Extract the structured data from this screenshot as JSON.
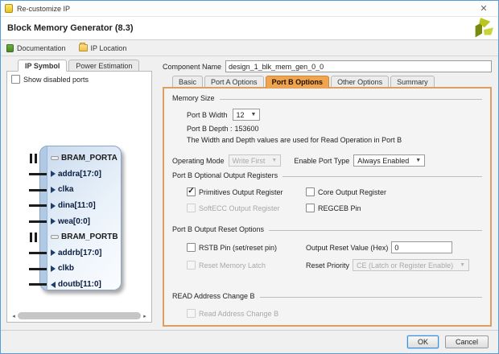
{
  "window": {
    "title": "Re-customize IP",
    "close_glyph": "✕"
  },
  "header": {
    "title": "Block Memory Generator (8.3)"
  },
  "toolbar": {
    "documentation_label": "Documentation",
    "ip_location_label": "IP Location"
  },
  "left_panel": {
    "tabs": [
      {
        "label": "IP Symbol"
      },
      {
        "label": "Power Estimation"
      }
    ],
    "show_disabled_ports_label": "Show disabled ports",
    "symbol_ports": [
      {
        "label": "BRAM_PORTA",
        "kind": "group"
      },
      {
        "label": "addra[17:0]",
        "kind": "input"
      },
      {
        "label": "clka",
        "kind": "input"
      },
      {
        "label": "dina[11:0]",
        "kind": "input"
      },
      {
        "label": "wea[0:0]",
        "kind": "input"
      },
      {
        "label": "BRAM_PORTB",
        "kind": "group"
      },
      {
        "label": "addrb[17:0]",
        "kind": "input"
      },
      {
        "label": "clkb",
        "kind": "input"
      },
      {
        "label": "doutb[11:0]",
        "kind": "output"
      }
    ]
  },
  "component_name": {
    "label": "Component Name",
    "value": "design_1_blk_mem_gen_0_0"
  },
  "config_tabs": [
    {
      "label": "Basic"
    },
    {
      "label": "Port A Options"
    },
    {
      "label": "Port B Options",
      "active": true
    },
    {
      "label": "Other Options"
    },
    {
      "label": "Summary"
    }
  ],
  "memory_size": {
    "title": "Memory Size",
    "port_b_width_label": "Port B Width",
    "port_b_width_value": "12",
    "port_b_depth_label": "Port B Depth :",
    "port_b_depth_value": "153600",
    "note": "The Width and Depth values are used for Read Operation in Port B"
  },
  "mode_row": {
    "operating_mode_label": "Operating Mode",
    "operating_mode_value": "Write First",
    "operating_mode_disabled": true,
    "enable_port_type_label": "Enable Port Type",
    "enable_port_type_value": "Always Enabled"
  },
  "output_registers": {
    "title": "Port B Optional Output Registers",
    "checkboxes": [
      {
        "label": "Primitives Output Register",
        "checked": true,
        "disabled": false
      },
      {
        "label": "Core Output Register",
        "checked": false,
        "disabled": false
      },
      {
        "label": "SoftECC Output Register",
        "checked": false,
        "disabled": true
      },
      {
        "label": "REGCEB Pin",
        "checked": false,
        "disabled": false
      }
    ]
  },
  "reset_options": {
    "title": "Port B Output Reset Options",
    "rstb_label": "RSTB Pin (set/reset pin)",
    "rstb_checked": false,
    "output_reset_value_label": "Output Reset Value (Hex)",
    "output_reset_value": "0",
    "reset_memory_latch_label": "Reset Memory Latch",
    "reset_memory_latch_disabled": true,
    "reset_priority_label": "Reset Priority",
    "reset_priority_value": "CE (Latch or Register Enable)",
    "reset_priority_disabled": true
  },
  "read_addr": {
    "title": "READ Address Change B",
    "checkbox_label": "Read Address Change B",
    "disabled": true
  },
  "footer": {
    "ok_label": "OK",
    "cancel_label": "Cancel"
  },
  "colors": {
    "accent_orange": "#f0a44e",
    "panel_border": "#de9e62",
    "window_border": "#559ede",
    "diagram_blue": "#c9daee",
    "port_arrow": "#1c3f6e"
  }
}
